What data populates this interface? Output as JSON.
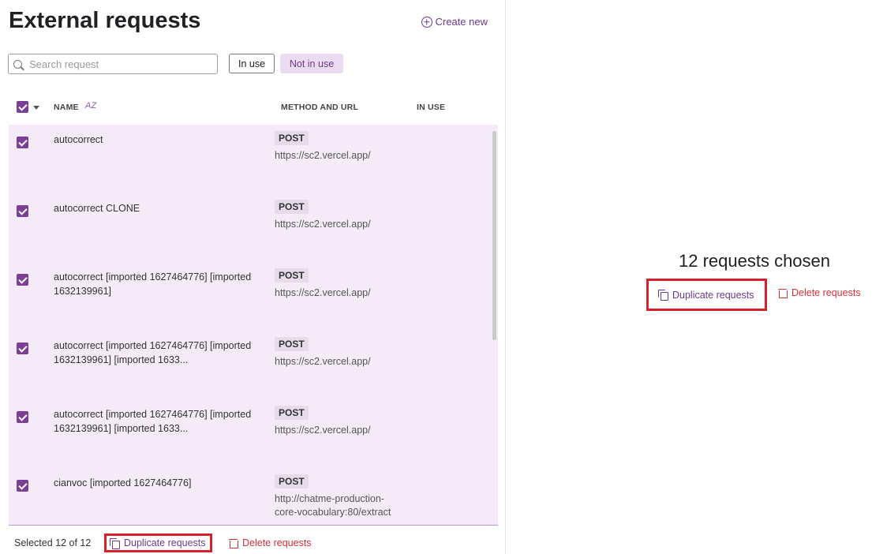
{
  "header": {
    "title": "External requests",
    "create_label": "Create new"
  },
  "filters": {
    "search_placeholder": "Search request",
    "in_use_label": "In use",
    "not_in_use_label": "Not in use"
  },
  "table": {
    "columns": {
      "name": "NAME",
      "method_url": "METHOD AND URL",
      "in_use": "IN USE"
    },
    "sort_icon_text": "AZ",
    "rows": [
      {
        "name": "autocorrect",
        "method": "POST",
        "url": "https://sc2.vercel.app/",
        "checked": true
      },
      {
        "name": "autocorrect CLONE",
        "method": "POST",
        "url": "https://sc2.vercel.app/",
        "checked": true
      },
      {
        "name": "autocorrect [imported 1627464776] [imported 1632139961]",
        "method": "POST",
        "url": "https://sc2.vercel.app/",
        "checked": true
      },
      {
        "name": "autocorrect [imported 1627464776] [imported 1632139961] [imported 1633...",
        "method": "POST",
        "url": "https://sc2.vercel.app/",
        "checked": true
      },
      {
        "name": "autocorrect [imported 1627464776] [imported 1632139961] [imported 1633...",
        "method": "POST",
        "url": "https://sc2.vercel.app/",
        "checked": true
      },
      {
        "name": "cianvoc [imported 1627464776]",
        "method": "POST",
        "url": "http://chatme-production-core-vocabulary:80/extract",
        "checked": true
      }
    ]
  },
  "footer": {
    "selected_text": "Selected 12 of 12",
    "duplicate_label": "Duplicate requests",
    "delete_label": "Delete requests"
  },
  "panel": {
    "count_text": "12 requests chosen",
    "duplicate_label": "Duplicate requests",
    "delete_label": "Delete requests"
  },
  "colors": {
    "accent": "#7b3f95",
    "selected_row_bg": "#f5ebf8",
    "danger": "#d6303a",
    "highlight_box": "#d6202c"
  }
}
